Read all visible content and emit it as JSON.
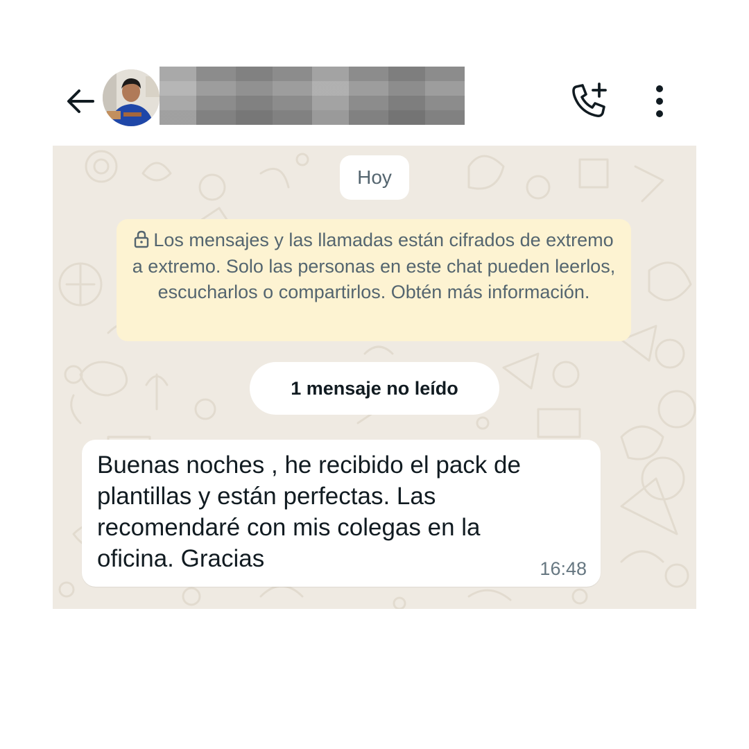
{
  "header": {
    "back_icon": "arrow-left-icon",
    "contact_name": "",
    "avatar_alt": "",
    "call_icon": "phone-plus-icon",
    "menu_icon": "dots-vertical-icon"
  },
  "chat": {
    "date_label": "Hoy",
    "encryption_notice": "Los mensajes y las llamadas están cifrados de extremo a extremo. Solo las personas en este chat pueden leerlos, escucharlos o compartirlos. Obtén más información.",
    "lock_icon": "lock-icon",
    "unread_label": "1 mensaje no leído",
    "messages": [
      {
        "text": "Buenas noches , he recibido el pack de plantillas y están perfectas. Las recomendaré con mis colegas en la oficina. Gracias",
        "time": "16:48"
      }
    ]
  },
  "colors": {
    "wallpaper": "#efeae2",
    "notice_bg": "#fdf3d2",
    "bubble_bg": "#ffffff",
    "icon_dark": "#111b21"
  }
}
